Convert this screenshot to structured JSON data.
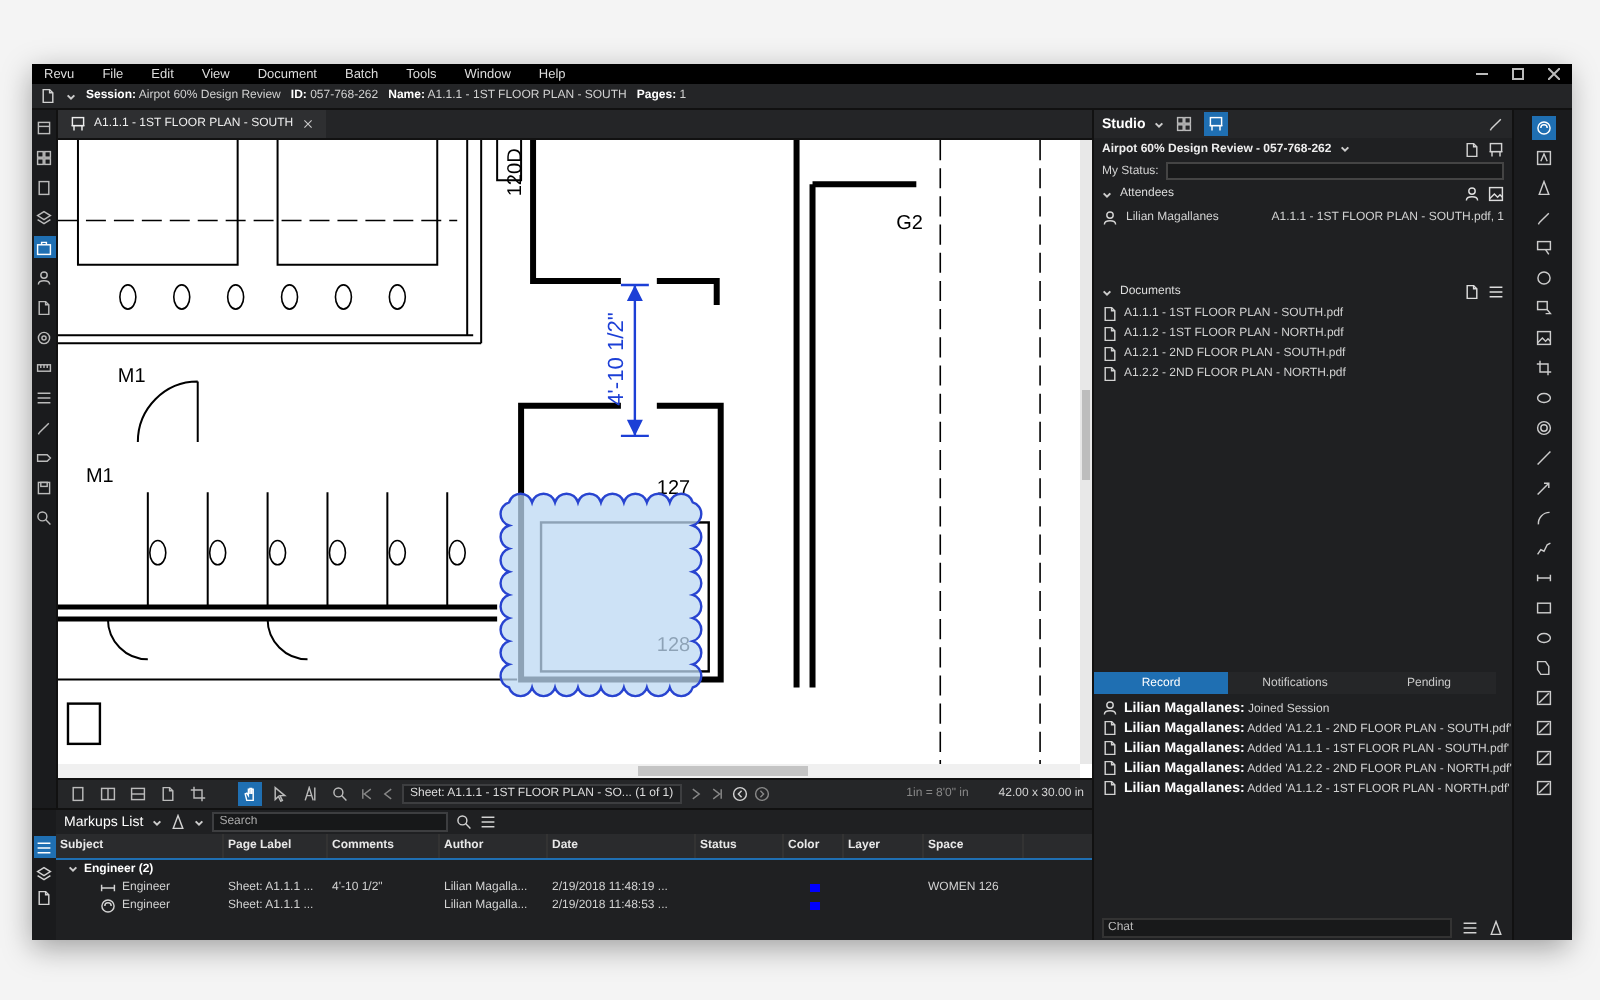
{
  "menu": [
    "Revu",
    "File",
    "Edit",
    "View",
    "Document",
    "Batch",
    "Tools",
    "Window",
    "Help"
  ],
  "session_bar": [
    {
      "label": "Session:",
      "value": "Airpot 60% Design Review"
    },
    {
      "label": "ID:",
      "value": "057-768-262"
    },
    {
      "label": "Name:",
      "value": "A1.1.1 - 1ST FLOOR PLAN - SOUTH"
    },
    {
      "label": "Pages:",
      "value": "1"
    }
  ],
  "left_panel_icons": [
    {
      "kind": "panel",
      "selected": false
    },
    {
      "kind": "grid",
      "selected": false
    },
    {
      "kind": "page",
      "selected": false
    },
    {
      "kind": "layers",
      "selected": false
    },
    {
      "kind": "briefcase",
      "selected": true
    },
    {
      "kind": "people",
      "selected": false
    },
    {
      "kind": "document",
      "selected": false
    },
    {
      "kind": "gear",
      "selected": false
    },
    {
      "kind": "ruler",
      "selected": false
    },
    {
      "kind": "list",
      "selected": false
    },
    {
      "kind": "pen",
      "selected": false
    },
    {
      "kind": "tag",
      "selected": false
    },
    {
      "kind": "disk",
      "selected": false
    },
    {
      "kind": "search",
      "selected": false
    }
  ],
  "tabs": [
    {
      "label": "A1.1.1 - 1ST FLOOR PLAN - SOUTH",
      "selected": true
    }
  ],
  "drawing": {
    "door_tag": "120D",
    "room_tags": [
      "G2",
      "M1",
      "M1",
      "127",
      "128"
    ],
    "dimension": "4'-10 1/2\""
  },
  "nav_bar": {
    "tools": [
      {
        "kind": "single",
        "selected": false
      },
      {
        "kind": "split_v",
        "selected": false
      },
      {
        "kind": "split_h",
        "selected": false
      },
      {
        "kind": "compare",
        "selected": false
      },
      {
        "kind": "crop",
        "selected": false
      },
      {
        "kind": "hand",
        "selected": true
      },
      {
        "kind": "select",
        "selected": false
      },
      {
        "kind": "text_select",
        "selected": false
      },
      {
        "kind": "zoom",
        "selected": false
      }
    ],
    "sheet": "Sheet: A1.1.1 - 1ST FLOOR PLAN - SO...",
    "page_count": "(1 of 1)",
    "scale": "1in = 8'0\" in",
    "size": "42.00 x 30.00 in"
  },
  "markups": {
    "title": "Markups List",
    "search_placeholder": "Search",
    "columns": [
      "Subject",
      "Page Label",
      "Comments",
      "Author",
      "Date",
      "Status",
      "Color",
      "Layer",
      "Space"
    ],
    "groups": [
      {
        "label": "Engineer (2)",
        "expanded": true,
        "rows": [
          {
            "kind": "dimension",
            "subject": "Engineer",
            "page_label": "Sheet: A1.1.1 ...",
            "comments": "4'-10 1/2\"",
            "author": "Lilian Magalla...",
            "date": "2/19/2018 11:48:19 ...",
            "color": "#0000ff",
            "space": "WOMEN 126"
          },
          {
            "kind": "cloud",
            "subject": "Engineer",
            "page_label": "Sheet: A1.1.1 ...",
            "author": "Lilian Magalla...",
            "date": "2/19/2018 11:48:53 ...",
            "color": "#0000ff"
          }
        ]
      }
    ]
  },
  "studio": {
    "title": "Studio",
    "modes": [
      {
        "kind": "sessions",
        "selected": false
      },
      {
        "kind": "projects",
        "selected": true
      }
    ],
    "session": "Airpot 60% Design Review - 057-768-262",
    "status_label": "My Status:",
    "attendees": {
      "title": "Attendees",
      "expanded": true,
      "items": [
        {
          "name": "Lilian Magallanes",
          "document": "A1.1.1 - 1ST FLOOR PLAN - SOUTH.pdf, 1"
        }
      ]
    },
    "documents": {
      "title": "Documents",
      "expanded": true,
      "items": [
        "A1.1.1 - 1ST FLOOR PLAN - SOUTH.pdf",
        "A1.1.2 - 1ST FLOOR PLAN - NORTH.pdf",
        "A1.2.1 - 2ND FLOOR PLAN - SOUTH.pdf",
        "A1.2.2 - 2ND FLOOR PLAN - NORTH.pdf"
      ]
    },
    "tabs": [
      {
        "label": "Record",
        "selected": true
      },
      {
        "label": "Notifications",
        "selected": false
      },
      {
        "label": "Pending",
        "selected": false
      }
    ],
    "record": [
      {
        "kind": "session",
        "name": "Lilian Magallanes:",
        "action": "Joined Session"
      },
      {
        "kind": "document",
        "name": "Lilian Magallanes:",
        "action": "Added 'A1.2.1 - 2ND FLOOR PLAN - SOUTH.pdf'"
      },
      {
        "kind": "document",
        "name": "Lilian Magallanes:",
        "action": "Added 'A1.1.1 - 1ST FLOOR PLAN - SOUTH.pdf'"
      },
      {
        "kind": "document",
        "name": "Lilian Magallanes:",
        "action": "Added 'A1.2.2 - 2ND FLOOR PLAN - NORTH.pdf'"
      },
      {
        "kind": "document",
        "name": "Lilian Magallanes:",
        "action": "Added 'A1.1.2 - 1ST FLOOR PLAN - NORTH.pdf'"
      }
    ],
    "chat_placeholder": "Chat"
  },
  "right_tools": [
    {
      "kind": "studio",
      "selected": true
    },
    {
      "kind": "text",
      "selected": false
    },
    {
      "kind": "highlight",
      "selected": false
    },
    {
      "kind": "pen",
      "selected": false
    },
    {
      "kind": "callout",
      "selected": false
    },
    {
      "kind": "circle",
      "selected": false
    },
    {
      "kind": "note",
      "selected": false
    },
    {
      "kind": "image",
      "selected": false
    },
    {
      "kind": "crop",
      "selected": false
    },
    {
      "kind": "ellipse",
      "selected": false
    },
    {
      "kind": "stamp",
      "selected": false
    },
    {
      "kind": "line",
      "selected": false
    },
    {
      "kind": "arrow",
      "selected": false
    },
    {
      "kind": "arc",
      "selected": false
    },
    {
      "kind": "polyline",
      "selected": false
    },
    {
      "kind": "dimension",
      "selected": false
    },
    {
      "kind": "rectangle",
      "selected": false
    },
    {
      "kind": "ellipse",
      "selected": false
    },
    {
      "kind": "area",
      "selected": false
    },
    {
      "kind": "measure",
      "selected": false
    },
    {
      "kind": "measure",
      "selected": false
    },
    {
      "kind": "measure",
      "selected": false
    },
    {
      "kind": "measure",
      "selected": false
    }
  ]
}
